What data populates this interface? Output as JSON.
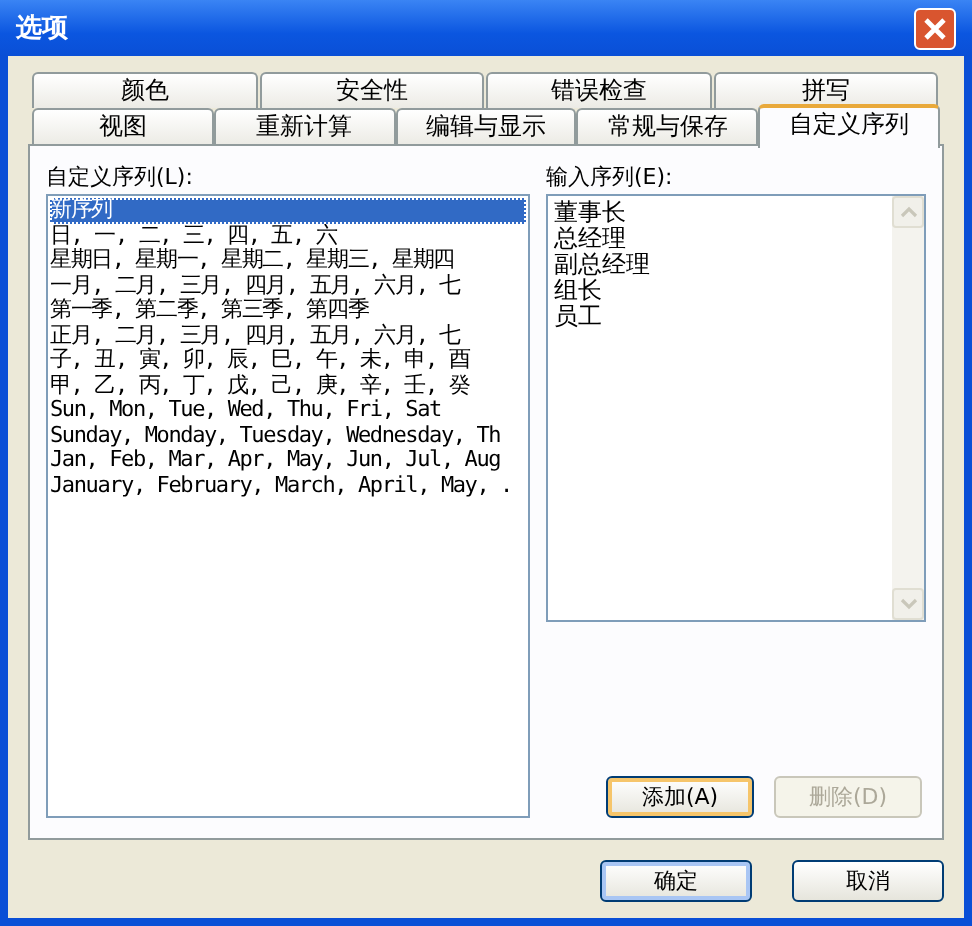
{
  "window": {
    "title": "选项"
  },
  "tab_rows": [
    [
      {
        "label": "颜色",
        "selected": false
      },
      {
        "label": "安全性",
        "selected": false
      },
      {
        "label": "错误检查",
        "selected": false
      },
      {
        "label": "拼写",
        "selected": false
      }
    ],
    [
      {
        "label": "视图",
        "selected": false
      },
      {
        "label": "重新计算",
        "selected": false
      },
      {
        "label": "编辑与显示",
        "selected": false
      },
      {
        "label": "常规与保存",
        "selected": false
      },
      {
        "label": "自定义序列",
        "selected": true
      }
    ]
  ],
  "custom_lists": {
    "label": "自定义序列(L):",
    "items": [
      {
        "text": "新序列",
        "selected": true
      },
      {
        "text": "日, 一, 二, 三, 四, 五, 六",
        "selected": false
      },
      {
        "text": "星期日, 星期一, 星期二, 星期三, 星期四",
        "selected": false
      },
      {
        "text": "一月, 二月, 三月, 四月, 五月, 六月, 七",
        "selected": false
      },
      {
        "text": "第一季, 第二季, 第三季, 第四季",
        "selected": false
      },
      {
        "text": "正月, 二月, 三月, 四月, 五月, 六月, 七",
        "selected": false
      },
      {
        "text": "子, 丑, 寅, 卯, 辰, 巳, 午, 未, 申, 酉",
        "selected": false
      },
      {
        "text": "甲, 乙, 丙, 丁, 戊, 己, 庚, 辛, 壬, 癸",
        "selected": false
      },
      {
        "text": "Sun, Mon, Tue, Wed, Thu, Fri, Sat",
        "selected": false
      },
      {
        "text": "Sunday, Monday, Tuesday, Wednesday, Th",
        "selected": false
      },
      {
        "text": "Jan, Feb, Mar, Apr, May, Jun, Jul, Aug",
        "selected": false
      },
      {
        "text": "January, February, March, April, May, .",
        "selected": false
      }
    ]
  },
  "list_entries": {
    "label": "输入序列(E):",
    "lines": [
      "董事长",
      "总经理",
      "副总经理",
      "组长",
      "员工"
    ]
  },
  "list_buttons": [
    {
      "label": "添加(A)",
      "disabled": false,
      "default": true
    },
    {
      "label": "删除(D)",
      "disabled": true,
      "default": false
    }
  ],
  "dialog_buttons": [
    {
      "label": "确定",
      "default": true
    },
    {
      "label": "取消",
      "default": false
    }
  ]
}
